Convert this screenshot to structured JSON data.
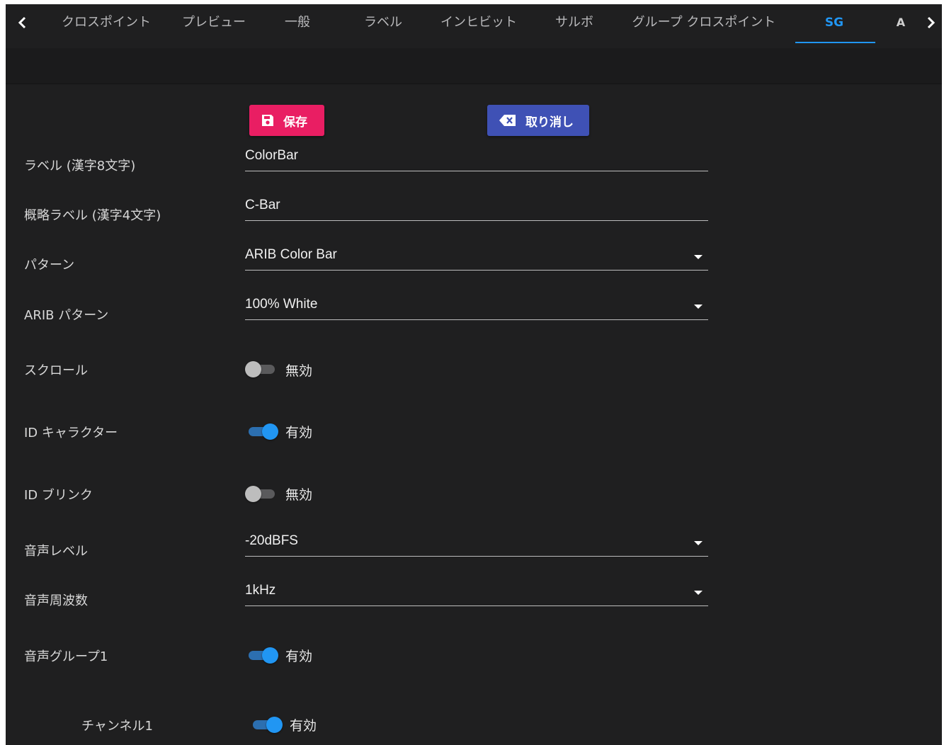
{
  "tabs": [
    {
      "label": "クロスポイント"
    },
    {
      "label": "プレビュー"
    },
    {
      "label": "一般"
    },
    {
      "label": "ラベル"
    },
    {
      "label": "インヒビット"
    },
    {
      "label": "サルボ"
    },
    {
      "label": "グループ クロスポイント"
    },
    {
      "label": "SG"
    },
    {
      "label": "A"
    }
  ],
  "active_tab": "SG",
  "accent_color": "#2196f3",
  "buttons": {
    "save_label": "保存",
    "cancel_label": "取り消し",
    "save_color": "#e91e63",
    "cancel_color": "#3f51b5"
  },
  "form": {
    "label": {
      "label": "ラベル (漢字8文字)",
      "value": "ColorBar"
    },
    "short_label": {
      "label": "概略ラベル (漢字4文字)",
      "value": "C-Bar"
    },
    "pattern": {
      "label": "パターン",
      "value": "ARIB Color Bar"
    },
    "arib_pattern": {
      "label": "ARIB パターン",
      "value": "100% White"
    },
    "scroll": {
      "label": "スクロール",
      "state": "無効",
      "on": false
    },
    "id_character": {
      "label": "ID キャラクター",
      "state": "有効",
      "on": true
    },
    "id_blink": {
      "label": "ID ブリンク",
      "state": "無効",
      "on": false
    },
    "audio_level": {
      "label": "音声レベル",
      "value": "-20dBFS"
    },
    "audio_frequency": {
      "label": "音声周波数",
      "value": "1kHz"
    },
    "audio_group1": {
      "label": "音声グループ1",
      "state": "有効",
      "on": true
    },
    "channel1": {
      "label": "チャンネル1",
      "state": "有効",
      "on": true
    }
  }
}
